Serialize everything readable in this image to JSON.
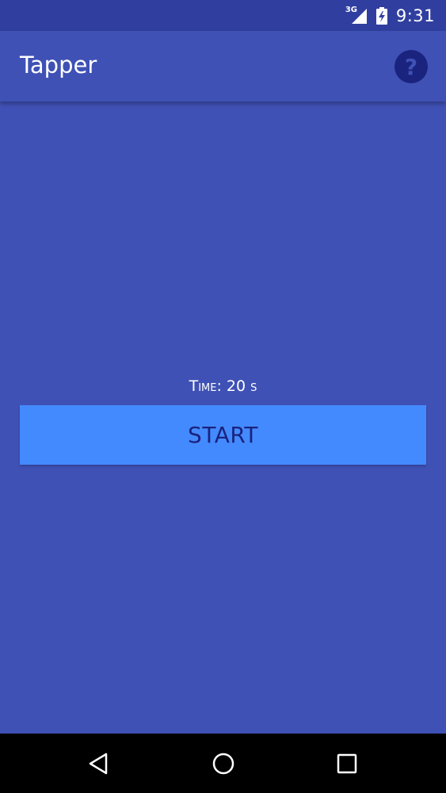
{
  "status_bar": {
    "network_label": "3G",
    "time": "9:31"
  },
  "app_bar": {
    "title": "Tapper",
    "help_icon": "help-circle-icon",
    "help_glyph": "?"
  },
  "main": {
    "time_label": "Time: 20 s",
    "start_button_label": "START"
  },
  "nav_bar": {
    "back_icon": "back-triangle-icon",
    "home_icon": "home-circle-icon",
    "recents_icon": "recents-square-icon"
  },
  "colors": {
    "status_bar": "#303f9f",
    "primary": "#3f51b5",
    "accent": "#448aff",
    "dark_text": "#1a237e",
    "nav_bar": "#000000"
  }
}
